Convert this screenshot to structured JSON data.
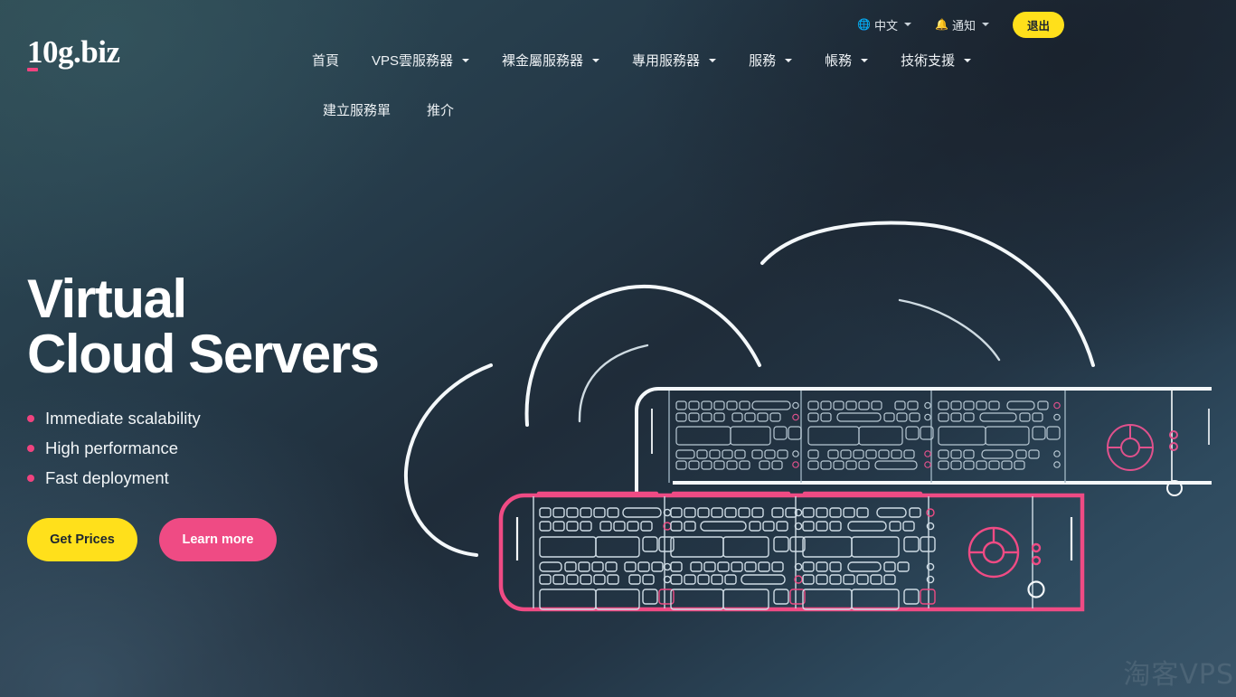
{
  "brand": {
    "logo_text": "10g.biz",
    "accent_pink": "#f0437f",
    "accent_yellow": "#ffe01b",
    "bg_dark": "#1f2833",
    "bg_teal": "#2d4a52",
    "bg_slate": "#3a5569"
  },
  "topbar": {
    "language": {
      "label": "中文",
      "icon": "globe-icon"
    },
    "notifications": {
      "label": "通知",
      "icon": "bell-icon"
    },
    "logout": {
      "label": "退出"
    }
  },
  "nav": {
    "row1": [
      {
        "label": "首頁",
        "has_dropdown": false
      },
      {
        "label": "VPS雲服務器",
        "has_dropdown": true
      },
      {
        "label": "裸金屬服務器",
        "has_dropdown": true
      },
      {
        "label": "專用服務器",
        "has_dropdown": true
      },
      {
        "label": "服務",
        "has_dropdown": true
      },
      {
        "label": "帳務",
        "has_dropdown": true
      },
      {
        "label": "技術支援",
        "has_dropdown": true
      }
    ],
    "row2": [
      {
        "label": "建立服務單",
        "has_dropdown": false
      },
      {
        "label": "推介",
        "has_dropdown": false
      }
    ]
  },
  "hero": {
    "title_line1": "Virtual",
    "title_line2": "Cloud Servers",
    "features": [
      "Immediate scalability",
      "High performance",
      "Fast deployment"
    ],
    "cta_primary": "Get Prices",
    "cta_secondary": "Learn more"
  },
  "watermark": {
    "text": "淘客VPS"
  }
}
